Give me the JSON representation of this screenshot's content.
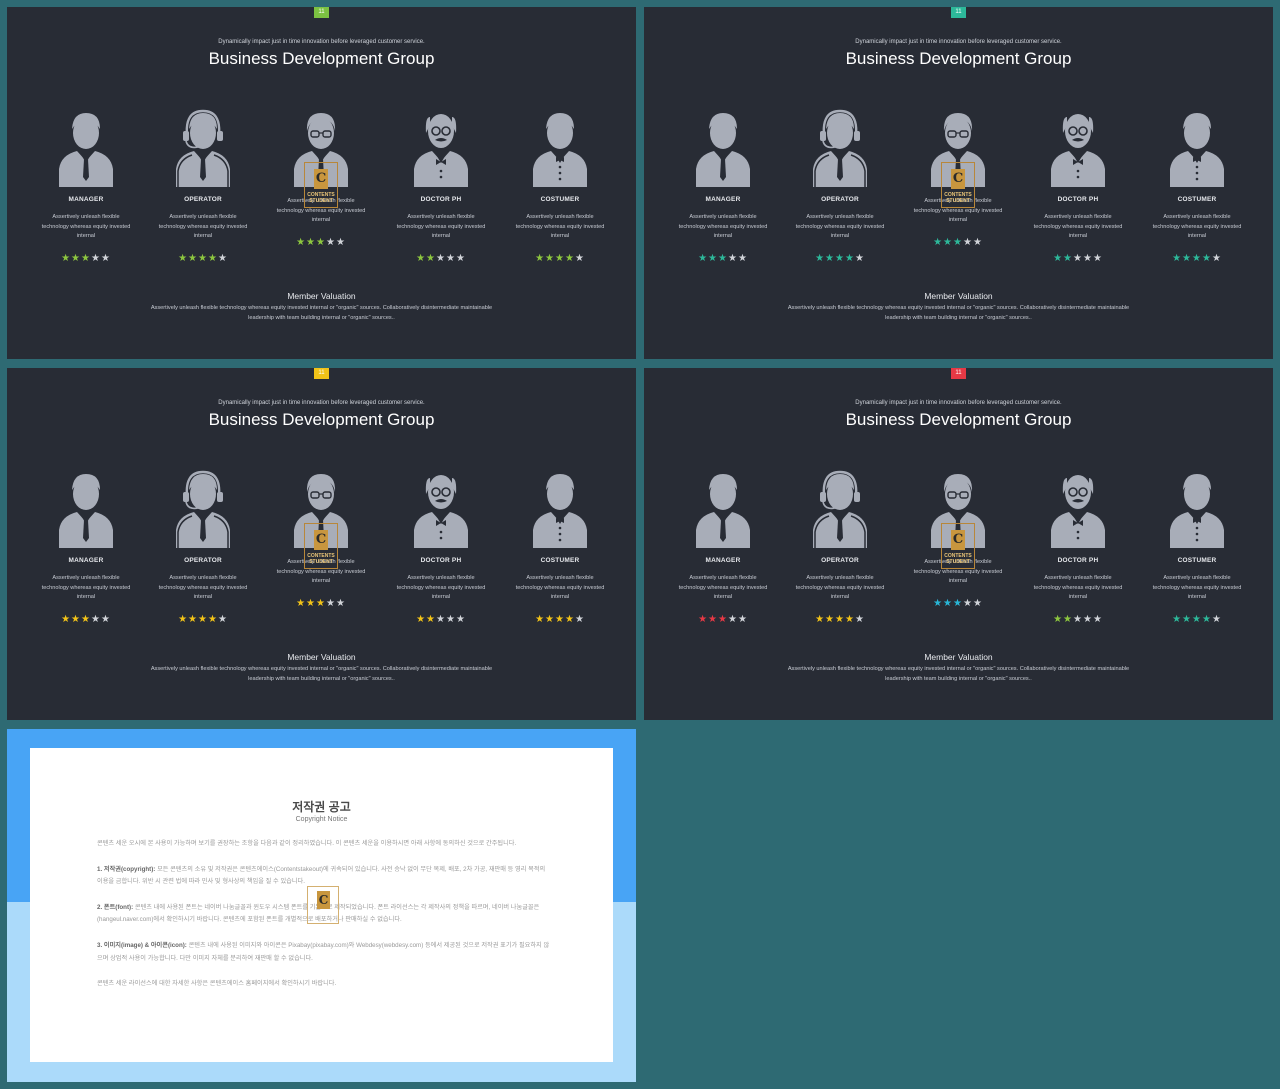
{
  "slides": [
    {
      "page": "11",
      "badge_color": "#7cc242",
      "star_color": "#8dc63f",
      "subtitle": "Dynamically impact just in time innovation  before leveraged customer service.",
      "title": "Business Development Group",
      "footer_title": "Member Valuation",
      "footer_text": "Assertively unleash flexible technology whereas equity invested internal or \"organic\" sources. Collaboratively disintermediate maintainable leadership with team building internal or \"organic\" sources..",
      "members": [
        {
          "role": "MANAGER",
          "desc": "Assertively unleash flexible technology whereas equity invested internal",
          "rating": 3
        },
        {
          "role": "OPERATOR",
          "desc": "Assertively unleash flexible technology whereas equity invested internal",
          "rating": 4
        },
        {
          "role": "",
          "desc": "Assertively unleash flexible technology whereas equity invested internal",
          "rating": 3
        },
        {
          "role": "DOCTOR PH",
          "desc": "Assertively unleash flexible technology whereas equity invested internal",
          "rating": 2
        },
        {
          "role": "COSTUMER",
          "desc": "Assertively unleash flexible technology whereas equity invested internal",
          "rating": 4
        }
      ]
    },
    {
      "page": "11",
      "badge_color": "#2db89a",
      "star_color": "#2db89a",
      "subtitle": "Dynamically impact just in time innovation  before leveraged customer service.",
      "title": "Business Development Group",
      "footer_title": "Member Valuation",
      "footer_text": "Assertively unleash flexible technology whereas equity invested internal or \"organic\" sources. Collaboratively disintermediate maintainable leadership with team building internal or \"organic\" sources..",
      "members": [
        {
          "role": "MANAGER",
          "desc": "Assertively unleash flexible technology whereas equity invested internal",
          "rating": 3
        },
        {
          "role": "OPERATOR",
          "desc": "Assertively unleash flexible technology whereas equity invested internal",
          "rating": 4
        },
        {
          "role": "",
          "desc": "Assertively unleash flexible technology whereas equity invested internal",
          "rating": 3
        },
        {
          "role": "DOCTOR PH",
          "desc": "Assertively unleash flexible technology whereas equity invested internal",
          "rating": 2
        },
        {
          "role": "COSTUMER",
          "desc": "Assertively unleash flexible technology whereas equity invested internal",
          "rating": 4
        }
      ]
    },
    {
      "page": "11",
      "badge_color": "#f2c318",
      "star_color": "#f2c318",
      "subtitle": "Dynamically impact just in time innovation  before leveraged customer service.",
      "title": "Business Development Group",
      "footer_title": "Member Valuation",
      "footer_text": "Assertively unleash flexible technology whereas equity invested internal or \"organic\" sources. Collaboratively disintermediate maintainable leadership with team building internal or \"organic\" sources..",
      "members": [
        {
          "role": "MANAGER",
          "desc": "Assertively unleash flexible technology whereas equity invested internal",
          "rating": 3
        },
        {
          "role": "OPERATOR",
          "desc": "Assertively unleash flexible technology whereas equity invested internal",
          "rating": 4
        },
        {
          "role": "",
          "desc": "Assertively unleash flexible technology whereas equity invested internal",
          "rating": 3
        },
        {
          "role": "DOCTOR PH",
          "desc": "Assertively unleash flexible technology whereas equity invested internal",
          "rating": 2
        },
        {
          "role": "COSTUMER",
          "desc": "Assertively unleash flexible technology whereas equity invested internal",
          "rating": 4
        }
      ]
    },
    {
      "page": "11",
      "badge_color": "#e53945",
      "star_color": "",
      "subtitle": "Dynamically impact just in time innovation  before leveraged customer service.",
      "title": "Business Development Group",
      "footer_title": "Member Valuation",
      "footer_text": "Assertively unleash flexible technology whereas equity invested internal or \"organic\" sources. Collaboratively disintermediate maintainable leadership with team building internal or \"organic\" sources..",
      "members": [
        {
          "role": "MANAGER",
          "desc": "Assertively unleash flexible technology whereas equity invested internal",
          "rating": 3,
          "star_color": "#e53945"
        },
        {
          "role": "OPERATOR",
          "desc": "Assertively unleash flexible technology whereas equity invested internal",
          "rating": 4,
          "star_color": "#f2c318"
        },
        {
          "role": "",
          "desc": "Assertively unleash flexible technology whereas equity invested internal",
          "rating": 3,
          "star_color": "#29b6d6"
        },
        {
          "role": "DOCTOR PH",
          "desc": "Assertively unleash flexible technology whereas equity invested internal",
          "rating": 2,
          "star_color": "#8dc63f"
        },
        {
          "role": "COSTUMER",
          "desc": "Assertively unleash flexible technology whereas equity invested internal",
          "rating": 4,
          "star_color": "#2db89a"
        }
      ]
    }
  ],
  "avatar_color": "#a8adb8",
  "empty_star_color": "#d0d3d8",
  "stamp_letter": "C",
  "stamp_text": "CONTENTS STUDENT",
  "notice": {
    "title": "저작권 공고",
    "subtitle": "Copyright Notice",
    "intro": "콘텐츠 세운 오시에 본 사용이 가능하며 보기를 권장하는 조항을 다음과 같이 정리하였습니다. 이 콘텐츠 세운을 이용하시면 아래 사항에 동의하신 것으로 간주됩니다.",
    "p1_head": "1. 저작권(copyright):",
    "p1": "모든 콘텐츠의 소유 및 저작권은 콘텐츠에이스(Contentstakeout)에 귀속되어 있습니다. 사전 승낙 없이 무단 복제, 배포, 2차 가공, 재판매 등 영리 목적의 이용을 금합니다. 위반 시 관련 법에 따라 민사 및 형사상의 책임을 질 수 있습니다.",
    "p2_head": "2. 폰트(font):",
    "p2": "콘텐츠 내에 사용된 폰트는 네이버 나눔글꼴과 윈도우 시스템 폰트를 기본으로 제작되었습니다. 폰트 라이선스는 각 제작사의 정책을 따르며, 네이버 나눔글꼴은 (hangeul.naver.com)에서 확인하시기 바랍니다. 콘텐츠에 포함된 폰트를 개별적으로 배포하거나 판매하실 수 없습니다.",
    "p3_head": "3. 이미지(image) & 아이콘(icon):",
    "p3": "콘텐츠 내에 사용된 이미지와 아이콘은 Pixabay(pixabay.com)와 Webdesy(webdesy.com) 등에서 제공된 것으로 저작권 표기가 필요하지 않으며 상업적 사용이 가능합니다. 다만 이미지 자체를 분리하여 재판매 할 수 없습니다.",
    "outro": "콘텐츠 세운 라이선스에 대한 자세한 사항은 콘텐츠에이스 홈페이지에서 확인하시기 바랍니다."
  }
}
